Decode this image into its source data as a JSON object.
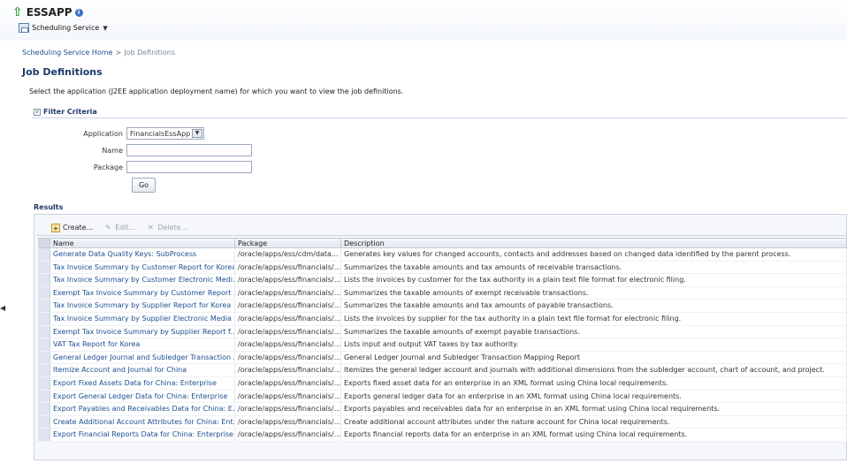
{
  "app": {
    "title": "ESSAPP",
    "service_label": "Scheduling Service"
  },
  "breadcrumb": {
    "home": "Scheduling Service Home",
    "separator": ">",
    "current": "Job Definitions"
  },
  "page": {
    "title": "Job Definitions",
    "instructions": "Select the application (J2EE application deployment name) for which you want to view the job definitions."
  },
  "filter": {
    "title": "Filter Criteria",
    "application_label": "Application",
    "application_value": "FinancialsEssApp",
    "name_label": "Name",
    "name_value": "",
    "package_label": "Package",
    "package_value": "",
    "go_label": "Go"
  },
  "results": {
    "title": "Results",
    "toolbar": {
      "create": "Create...",
      "edit": "Edit...",
      "delete": "Delete..."
    },
    "columns": {
      "name": "Name",
      "package": "Package",
      "description": "Description"
    },
    "rows": [
      {
        "name": "Generate Data Quality Keys: SubProcess",
        "package": "/oracle/apps/ess/cdm/data...",
        "description": "Generates key values for changed accounts, contacts and addresses based on changed data identified by the parent process."
      },
      {
        "name": "Tax Invoice Summary by Customer Report for Korea",
        "package": "/oracle/apps/ess/financials/...",
        "description": "Summarizes the taxable amounts and tax amounts of receivable transactions."
      },
      {
        "name": "Tax Invoice Summary by Customer Electronic Medi...",
        "package": "/oracle/apps/ess/financials/...",
        "description": "Lists the invoices by customer for the tax authority in a plain text file format for electronic filing."
      },
      {
        "name": "Exempt Tax Invoice Summary by Customer Report ...",
        "package": "/oracle/apps/ess/financials/...",
        "description": "Summarizes the taxable amounts of exempt receivable transactions."
      },
      {
        "name": "Tax Invoice Summary by Supplier Report for Korea",
        "package": "/oracle/apps/ess/financials/...",
        "description": "Summarizes the taxable amounts and tax amounts of payable transactions."
      },
      {
        "name": "Tax Invoice Summary by Supplier Electronic Media ...",
        "package": "/oracle/apps/ess/financials/...",
        "description": "Lists the invoices by supplier for the tax authority in a plain text file format for electronic filing."
      },
      {
        "name": "Exempt Tax Invoice Summary by Supplier Report f...",
        "package": "/oracle/apps/ess/financials/...",
        "description": "Summarizes the taxable amounts of exempt payable transactions."
      },
      {
        "name": "VAT Tax Report for Korea",
        "package": "/oracle/apps/ess/financials/...",
        "description": "Lists input and output VAT taxes by tax authority."
      },
      {
        "name": "General Ledger Journal and Subledger Transaction ...",
        "package": "/oracle/apps/ess/financials/...",
        "description": "General Ledger Journal and Subledger Transaction Mapping Report"
      },
      {
        "name": "Itemize Account and Journal for China",
        "package": "/oracle/apps/ess/financials/...",
        "description": "Itemizes the general ledger account and journals with additional dimensions from the subledger account, chart of account, and project."
      },
      {
        "name": "Export Fixed Assets Data for China: Enterprise",
        "package": "/oracle/apps/ess/financials/...",
        "description": "Exports fixed asset data for an enterprise in an XML format using China local requirements."
      },
      {
        "name": "Export General Ledger Data for China: Enterprise",
        "package": "/oracle/apps/ess/financials/...",
        "description": "Exports general ledger data for an enterprise in an XML format using China local requirements."
      },
      {
        "name": "Export Payables and Receivables Data for China: E...",
        "package": "/oracle/apps/ess/financials/...",
        "description": "Exports payables and receivables data for an enterprise in an XML format using China local requirements."
      },
      {
        "name": "Create Additional Account Attributes for China: Ent...",
        "package": "/oracle/apps/ess/financials/...",
        "description": "Create additional account attributes under the nature account for China local requirements."
      },
      {
        "name": "Export Financial Reports Data for China: Enterprise",
        "package": "/oracle/apps/ess/financials/...",
        "description": "Exports financial reports data for an enterprise in an XML format using China local requirements."
      }
    ]
  }
}
